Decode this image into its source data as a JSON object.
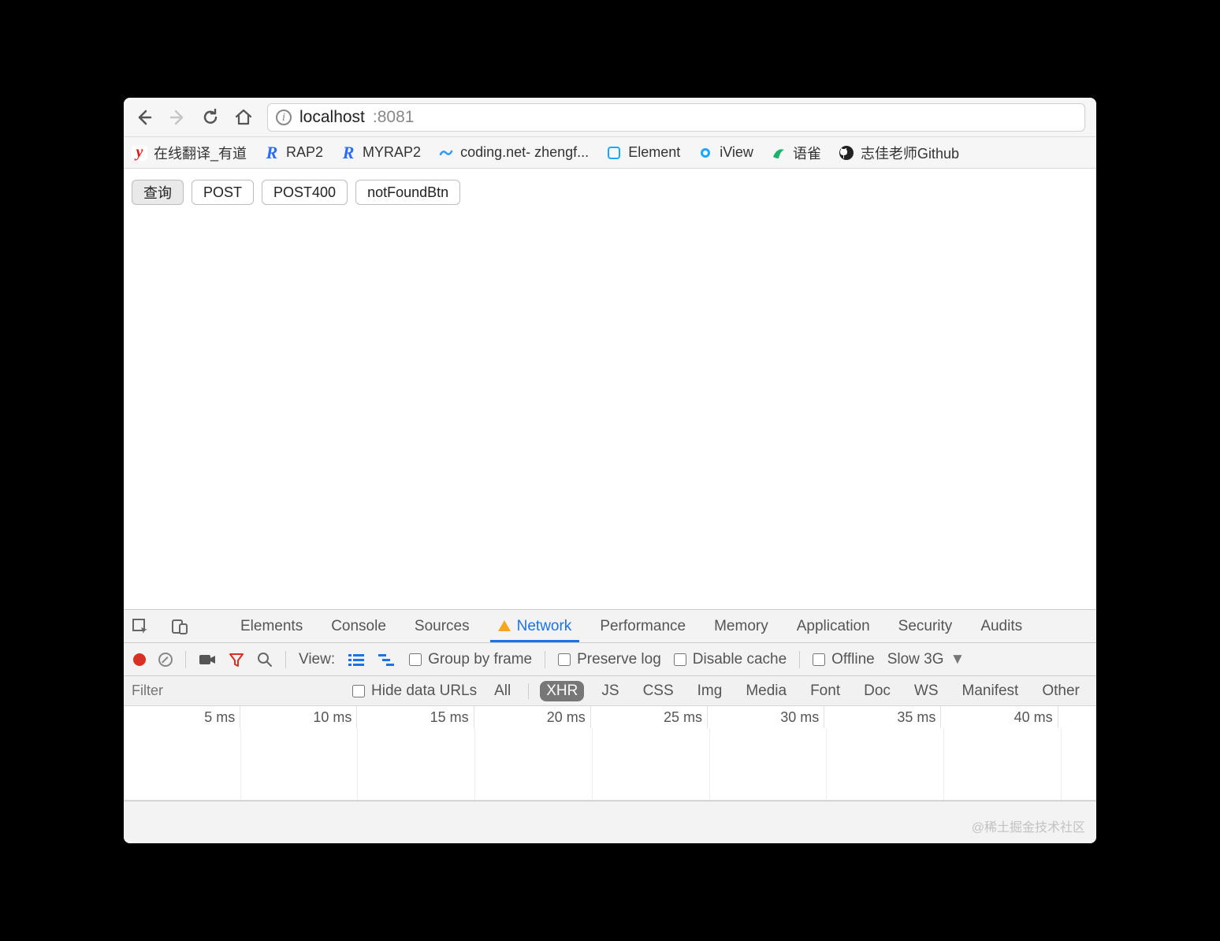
{
  "address": {
    "host": "localhost",
    "port": ":8081"
  },
  "bookmarks": [
    {
      "label": "在线翻译_有道",
      "icon": "youdao"
    },
    {
      "label": "RAP2",
      "icon": "rap"
    },
    {
      "label": "MYRAP2",
      "icon": "rap"
    },
    {
      "label": "coding.net- zhengf...",
      "icon": "coding"
    },
    {
      "label": "Element",
      "icon": "element"
    },
    {
      "label": "iView",
      "icon": "iview"
    },
    {
      "label": "语雀",
      "icon": "yuque"
    },
    {
      "label": "志佳老师Github",
      "icon": "github"
    }
  ],
  "page_buttons": {
    "query": "查询",
    "post": "POST",
    "post400": "POST400",
    "notfound": "notFoundBtn"
  },
  "devtools": {
    "tabs": {
      "elements": "Elements",
      "console": "Console",
      "sources": "Sources",
      "network": "Network",
      "performance": "Performance",
      "memory": "Memory",
      "application": "Application",
      "security": "Security",
      "audits": "Audits"
    },
    "controls": {
      "view": "View:",
      "group": "Group by frame",
      "preserve": "Preserve log",
      "disable": "Disable cache",
      "offline": "Offline",
      "throttle": "Slow 3G"
    },
    "filter": {
      "placeholder": "Filter",
      "hide": "Hide data URLs",
      "types": {
        "all": "All",
        "xhr": "XHR",
        "js": "JS",
        "css": "CSS",
        "img": "Img",
        "media": "Media",
        "font": "Font",
        "doc": "Doc",
        "ws": "WS",
        "manifest": "Manifest",
        "other": "Other"
      }
    },
    "timeline_ticks": [
      "5 ms",
      "10 ms",
      "15 ms",
      "20 ms",
      "25 ms",
      "30 ms",
      "35 ms",
      "40 ms"
    ]
  },
  "watermark": "@稀土掘金技术社区"
}
